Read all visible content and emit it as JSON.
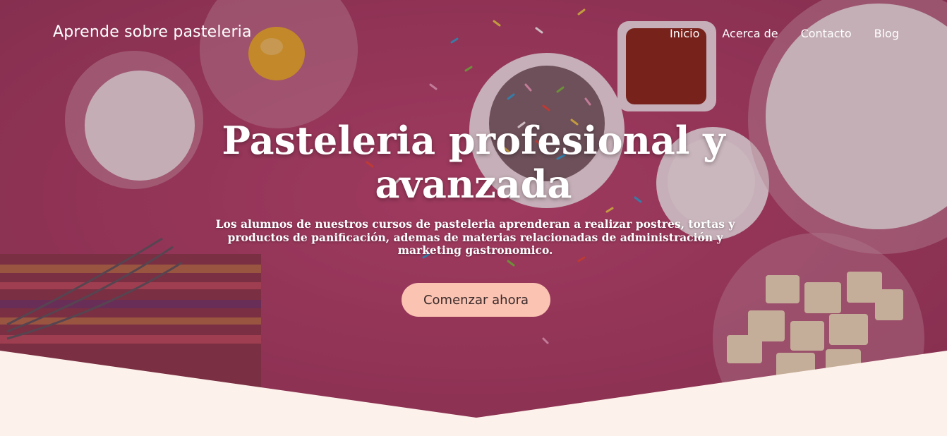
{
  "nav": {
    "brand": "Aprende sobre pasteleria",
    "links": [
      "Inicio",
      "Acerca de",
      "Contacto",
      "Blog"
    ]
  },
  "hero": {
    "title_line1": "Pasteleria profesional y",
    "title_line2": "avanzada",
    "subtitle": "Los alumnos de nuestros cursos de pasteleria aprenderan a realizar postres, tortas y productos de panificación, ademas de materias relacionadas de administración y marketing gastronomico.",
    "cta_label": "Comenzar ahora"
  },
  "colors": {
    "overlay": "#b5446d",
    "cream": "#fdf1eb",
    "cta_bg": "#fbc3b2"
  }
}
